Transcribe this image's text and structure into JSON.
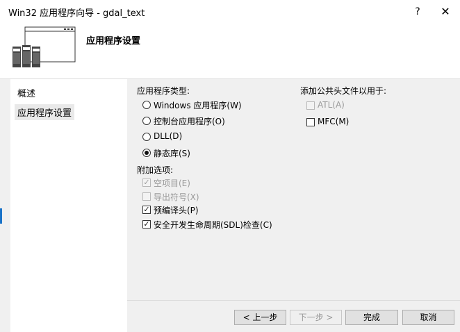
{
  "window": {
    "title": "Win32 应用程序向导 - gdal_text",
    "help_label": "?",
    "close_label": "✕"
  },
  "header": {
    "title": "应用程序设置",
    "icon": "application-wizard-icon"
  },
  "nav": {
    "items": [
      {
        "label": "概述",
        "selected": false
      },
      {
        "label": "应用程序设置",
        "selected": true
      }
    ]
  },
  "app_type": {
    "heading": "应用程序类型:",
    "options": [
      {
        "label": "Windows 应用程序(W)",
        "checked": false
      },
      {
        "label": "控制台应用程序(O)",
        "checked": false
      },
      {
        "label": "DLL(D)",
        "checked": false
      },
      {
        "label": "静态库(S)",
        "checked": true
      }
    ]
  },
  "additional": {
    "heading": "附加选项:",
    "options": [
      {
        "label": "空项目(E)",
        "checked": true,
        "disabled": true
      },
      {
        "label": "导出符号(X)",
        "checked": false,
        "disabled": true
      },
      {
        "label": "预编译头(P)",
        "checked": true,
        "disabled": false
      },
      {
        "label": "安全开发生命周期(SDL)检查(C)",
        "checked": true,
        "disabled": false
      }
    ]
  },
  "common_headers": {
    "heading": "添加公共头文件以用于:",
    "options": [
      {
        "label": "ATL(A)",
        "checked": false,
        "disabled": true
      },
      {
        "label": "MFC(M)",
        "checked": false,
        "disabled": false
      }
    ]
  },
  "buttons": {
    "prev": "< 上一步",
    "next": "下一步 >",
    "finish": "完成",
    "cancel": "取消"
  }
}
